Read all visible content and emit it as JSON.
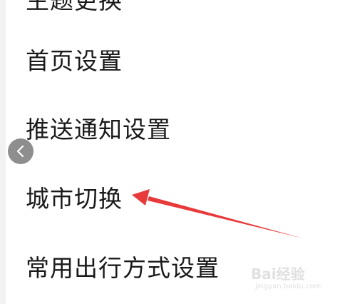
{
  "menu": {
    "items": [
      {
        "label": "主题更换"
      },
      {
        "label": "首页设置"
      },
      {
        "label": "推送通知设置"
      },
      {
        "label": "城市切换"
      },
      {
        "label": "常用出行方式设置"
      }
    ]
  },
  "back_button": {
    "icon": "chevron-left-icon"
  },
  "annotation": {
    "icon": "red-arrow-pointer",
    "color": "#e83a3a",
    "points_to": "城市切换"
  },
  "watermark": {
    "logo_text": "Bai经验",
    "url": "jingyan.baidu.com"
  }
}
